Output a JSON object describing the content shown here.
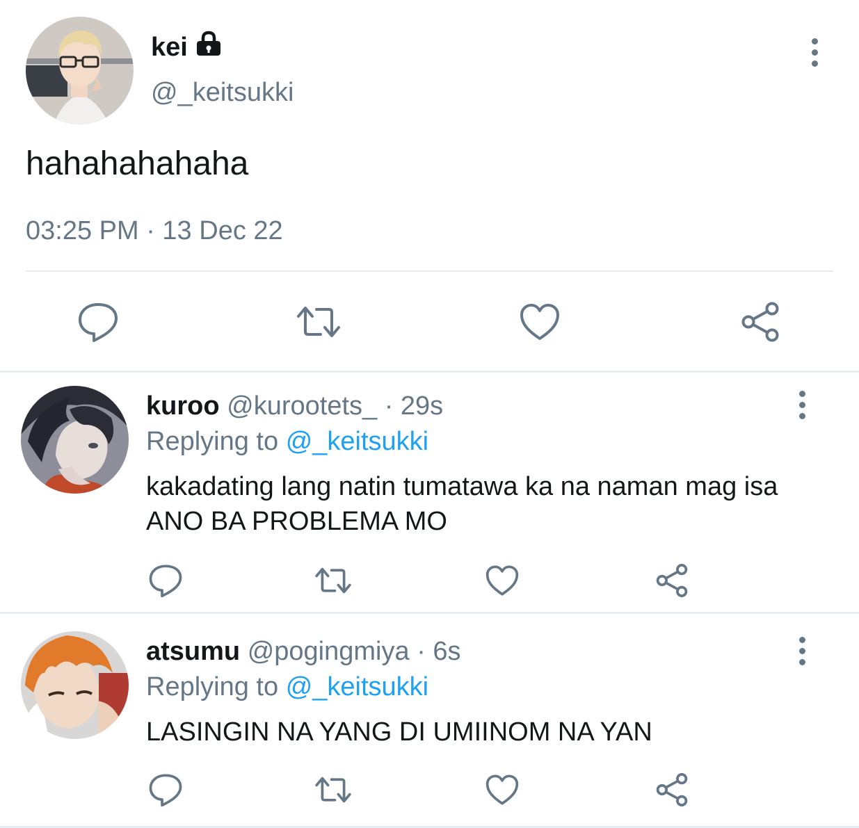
{
  "main_tweet": {
    "display_name": "kei",
    "handle": "@_keitsukki",
    "text": "hahahahahaha",
    "timestamp": "03:25 PM · 13 Dec 22",
    "avatar_icon": "avatar-keitsukki",
    "protected_icon": "lock-icon"
  },
  "actions": [
    "reply-icon",
    "retweet-icon",
    "like-icon",
    "share-icon"
  ],
  "replies": [
    {
      "display_name": "kuroo",
      "handle": "@kurootets_",
      "time": "· 29s",
      "replying_prefix": "Replying to",
      "replying_to": "@_keitsukki",
      "text": "kakadating lang natin tumatawa ka na naman mag isa ANO BA PROBLEMA MO"
    },
    {
      "display_name": "atsumu",
      "handle": "@pogingmiya",
      "time": "· 6s",
      "replying_prefix": "Replying to",
      "replying_to": "@_keitsukki",
      "text": "LASINGIN NA YANG DI UMIINOM NA YAN"
    }
  ],
  "colors": {
    "text_primary": "#14171a",
    "text_secondary": "#657786",
    "mention": "#1da1f2",
    "icon": "#657786",
    "divider": "#e6ecf0"
  }
}
